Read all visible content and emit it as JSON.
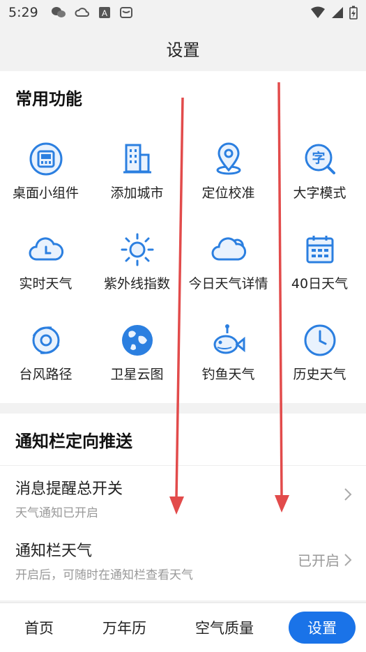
{
  "status": {
    "time": "5:29"
  },
  "header": {
    "title": "设置"
  },
  "common": {
    "title": "常用功能",
    "items": [
      {
        "label": "桌面小组件",
        "icon": "widget-icon"
      },
      {
        "label": "添加城市",
        "icon": "building-icon"
      },
      {
        "label": "定位校准",
        "icon": "location-pin-icon"
      },
      {
        "label": "大字模式",
        "icon": "large-font-icon"
      },
      {
        "label": "实时天气",
        "icon": "cloud-clock-icon"
      },
      {
        "label": "紫外线指数",
        "icon": "sun-icon"
      },
      {
        "label": "今日天气详情",
        "icon": "cloud-icon"
      },
      {
        "label": "40日天气",
        "icon": "calendar-icon"
      },
      {
        "label": "台风路径",
        "icon": "typhoon-icon"
      },
      {
        "label": "卫星云图",
        "icon": "globe-icon"
      },
      {
        "label": "钓鱼天气",
        "icon": "fish-icon"
      },
      {
        "label": "历史天气",
        "icon": "clock-icon"
      }
    ]
  },
  "notify": {
    "title": "通知栏定向推送",
    "rows": [
      {
        "title": "消息提醒总开关",
        "subtitle": "天气通知已开启",
        "value": ""
      },
      {
        "title": "通知栏天气",
        "subtitle": "开启后，可随时在通知栏查看天气",
        "value": "已开启"
      }
    ]
  },
  "nav": {
    "items": [
      {
        "label": "首页"
      },
      {
        "label": "万年历"
      },
      {
        "label": "空气质量"
      },
      {
        "label": "设置"
      }
    ]
  },
  "colors": {
    "accent": "#1a73e8",
    "icon_blue": "#2b7fe0",
    "annotation_arrow": "#e24b4b"
  }
}
